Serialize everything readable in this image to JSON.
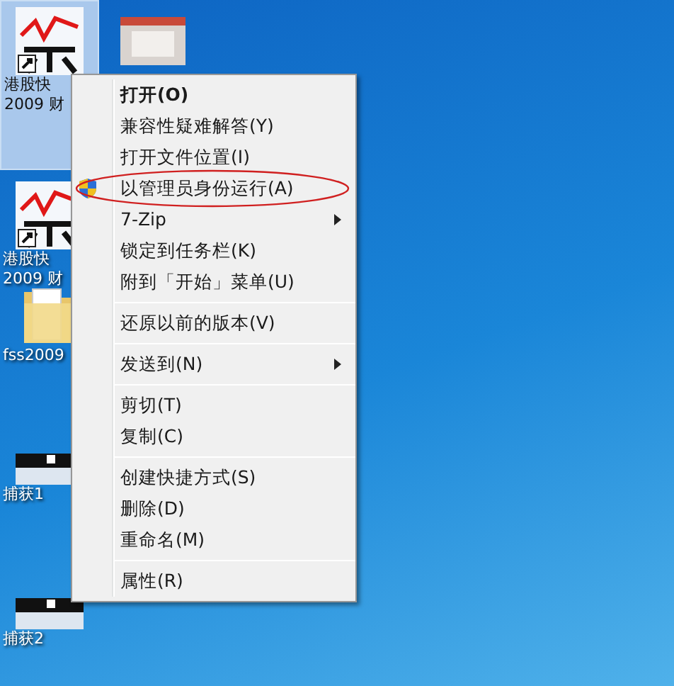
{
  "desktop_icons": [
    {
      "kind": "app",
      "lines": [
        "港股快",
        "2009 财"
      ],
      "selected": true
    },
    {
      "kind": "app",
      "lines": [
        "港股快",
        "2009 财"
      ],
      "selected": false
    },
    {
      "kind": "folder",
      "lines": [
        "fss2009"
      ],
      "selected": false
    },
    {
      "kind": "image",
      "lines": [
        "捕获1"
      ],
      "selected": false
    },
    {
      "kind": "image",
      "lines": [
        "捕获2"
      ],
      "selected": false
    },
    {
      "kind": "thumbnail",
      "selected": false
    }
  ],
  "context_menu": {
    "items": [
      {
        "kind": "item",
        "label": "打开(O)",
        "default": true,
        "submenu": false,
        "shield": false,
        "circled": false
      },
      {
        "kind": "item",
        "label": "兼容性疑难解答(Y)",
        "default": false,
        "submenu": false,
        "shield": false,
        "circled": false
      },
      {
        "kind": "item",
        "label": "打开文件位置(I)",
        "default": false,
        "submenu": false,
        "shield": false,
        "circled": false
      },
      {
        "kind": "item",
        "label": "以管理员身份运行(A)",
        "default": false,
        "submenu": false,
        "shield": true,
        "circled": true
      },
      {
        "kind": "item",
        "label": "7-Zip",
        "default": false,
        "submenu": true,
        "shield": false,
        "circled": false
      },
      {
        "kind": "item",
        "label": "锁定到任务栏(K)",
        "default": false,
        "submenu": false,
        "shield": false,
        "circled": false
      },
      {
        "kind": "item",
        "label": "附到「开始」菜单(U)",
        "default": false,
        "submenu": false,
        "shield": false,
        "circled": false
      },
      {
        "kind": "separator"
      },
      {
        "kind": "item",
        "label": "还原以前的版本(V)",
        "default": false,
        "submenu": false,
        "shield": false,
        "circled": false
      },
      {
        "kind": "separator"
      },
      {
        "kind": "item",
        "label": "发送到(N)",
        "default": false,
        "submenu": true,
        "shield": false,
        "circled": false
      },
      {
        "kind": "separator"
      },
      {
        "kind": "item",
        "label": "剪切(T)",
        "default": false,
        "submenu": false,
        "shield": false,
        "circled": false
      },
      {
        "kind": "item",
        "label": "复制(C)",
        "default": false,
        "submenu": false,
        "shield": false,
        "circled": false
      },
      {
        "kind": "separator"
      },
      {
        "kind": "item",
        "label": "创建快捷方式(S)",
        "default": false,
        "submenu": false,
        "shield": false,
        "circled": false
      },
      {
        "kind": "item",
        "label": "删除(D)",
        "default": false,
        "submenu": false,
        "shield": false,
        "circled": false
      },
      {
        "kind": "item",
        "label": "重命名(M)",
        "default": false,
        "submenu": false,
        "shield": false,
        "circled": false
      },
      {
        "kind": "separator"
      },
      {
        "kind": "item",
        "label": "属性(R)",
        "default": false,
        "submenu": false,
        "shield": false,
        "circled": false
      }
    ]
  }
}
